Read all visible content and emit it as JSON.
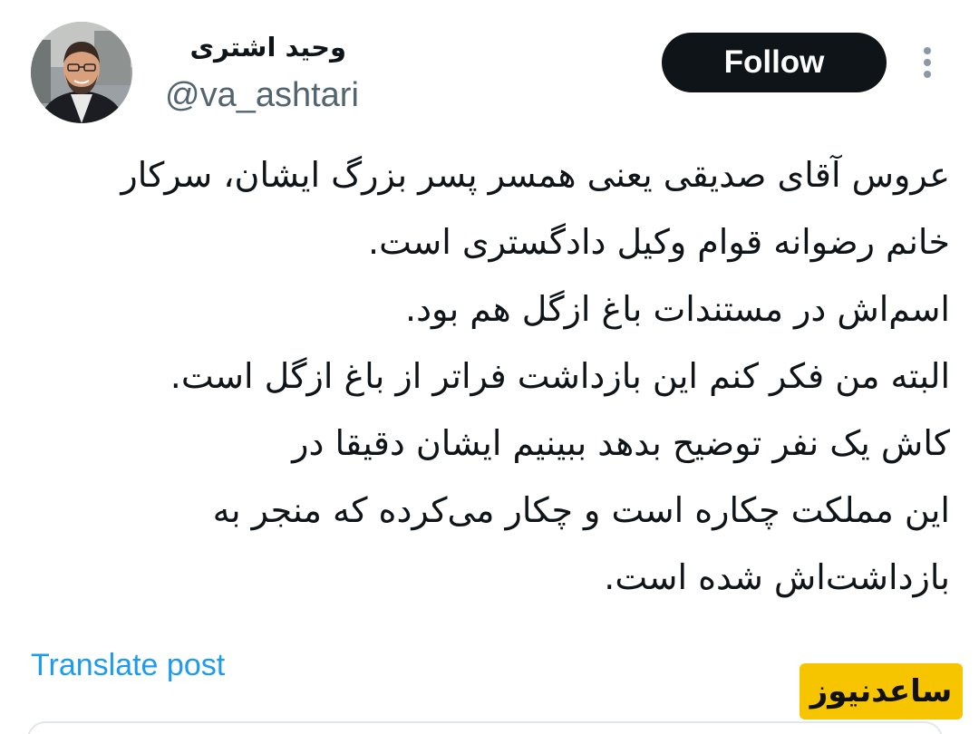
{
  "author": {
    "display_name": "وحید اشتری",
    "handle": "@va_ashtari"
  },
  "actions": {
    "follow_label": "Follow",
    "more_icon": "more-vertical-icon"
  },
  "post": {
    "lines": [
      "عروس آقای صدیقی یعنی همسر پسر بزرگ ایشان، سرکار",
      "خانم رضوانه قوام وکیل دادگستری است.",
      "اسم‌اش در مستندات باغ ازگل هم بود.",
      "البته من فکر کنم این بازداشت فراتر از باغ ازگل است.",
      "کاش یک نفر توضیح بدهد ببینیم ایشان دقیقا در",
      "این مملکت چکاره است و چکار می‌کرده که منجر به",
      "بازداشت‌اش شده است."
    ],
    "translate_label": "Translate post"
  },
  "watermark": {
    "text": "ساعدنیوز"
  },
  "colors": {
    "text": "#0f1419",
    "secondary": "#536471",
    "link": "#1d9bf0",
    "follow_bg": "#0f1419",
    "watermark_bg": "#f7c400"
  }
}
